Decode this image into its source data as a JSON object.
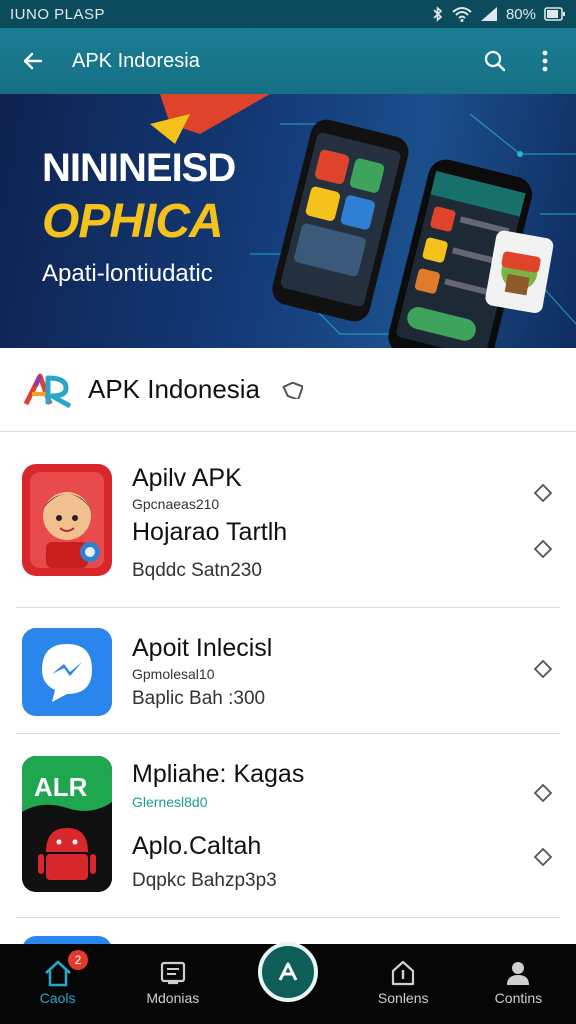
{
  "status_bar": {
    "carrier": "IUNO PLASP",
    "battery": "80%"
  },
  "app_bar": {
    "title": "APK Indoresia"
  },
  "banner": {
    "line1": "NININEISD",
    "line2": "OPHICA",
    "line3": "Apati-lontiudatic"
  },
  "header": {
    "title": "APK Indonesia"
  },
  "apps": [
    {
      "title": "Apilv APK",
      "subtitle": "Gpcnaeas210",
      "name": "Hojarao Tartlh",
      "meta": "Bqddc Satn230",
      "subtitle_color": "#333333"
    },
    {
      "title": "Apoit Inlecisl",
      "subtitle": "Gpmolesal10",
      "meta": "Baplic Bah :300",
      "subtitle_color": "#333333"
    },
    {
      "title": "Mpliahe: Kagas",
      "subtitle": "Glernesl8d0",
      "name": "Aplo.Caltah",
      "meta": "Dqpkc Bahzp3p3",
      "subtitle_color": "#1a9b8f"
    }
  ],
  "bottom_nav": {
    "tabs": [
      {
        "label": "Caols",
        "icon": "home-icon",
        "badge": "2"
      },
      {
        "label": "Mdonias",
        "icon": "downloads-icon"
      },
      {
        "label": "Sonlens",
        "icon": "updates-icon"
      },
      {
        "label": "Contins",
        "icon": "profile-icon"
      }
    ],
    "center_icon": "apk-logo-icon"
  },
  "colors": {
    "app_bar": "#1a7e94",
    "accent": "#2aa6c8",
    "banner_yellow": "#f4c21a",
    "badge": "#e23a2b"
  }
}
